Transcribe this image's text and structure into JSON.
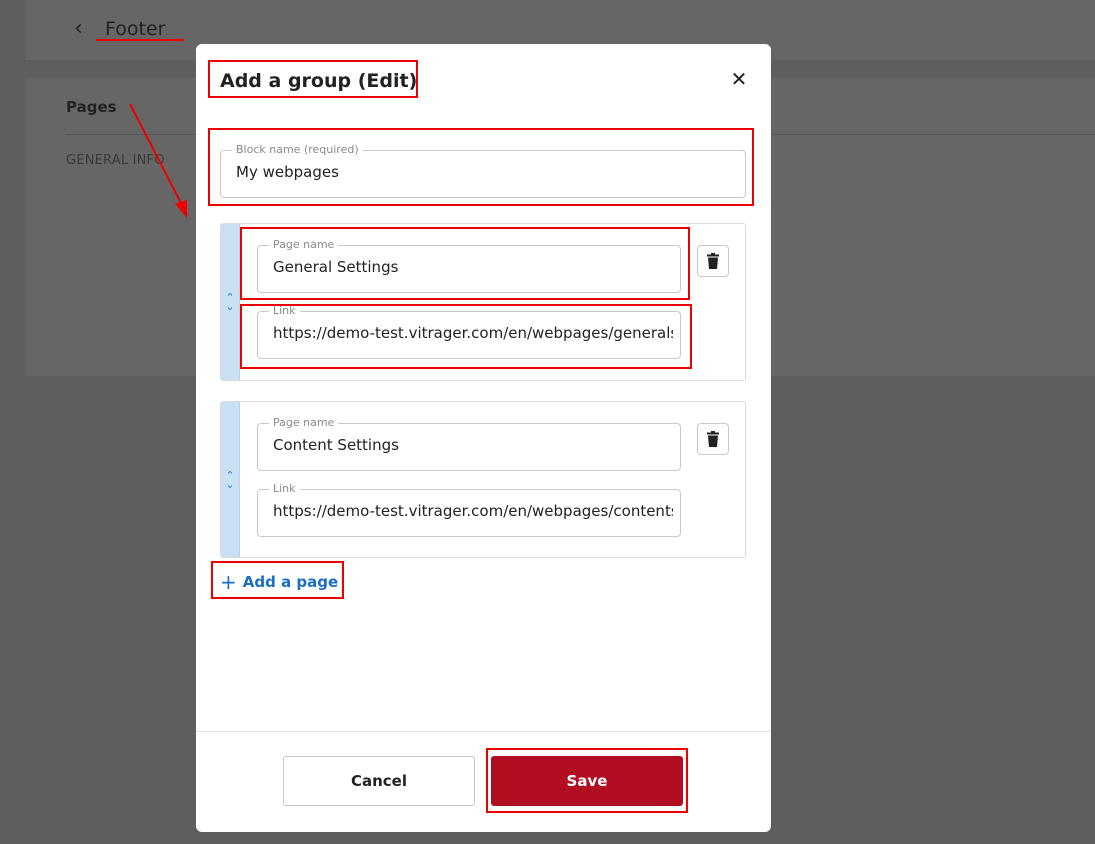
{
  "background": {
    "title": "Footer",
    "section_label": "Pages",
    "section_item": "GENERAL INFO",
    "back_icon": "chevron-left-icon"
  },
  "modal": {
    "title": "Add a group (Edit)",
    "close_icon": "close-icon",
    "block_name": {
      "label": "Block name (required)",
      "value": "My webpages"
    },
    "groups": [
      {
        "page_name_label": "Page name",
        "page_name_value": "General Settings",
        "link_label": "Link",
        "link_value": "https://demo-test.vitrager.com/en/webpages/generalsettings"
      },
      {
        "page_name_label": "Page name",
        "page_name_value": "Content Settings",
        "link_label": "Link",
        "link_value": "https://demo-test.vitrager.com/en/webpages/contentsettings"
      }
    ],
    "add_page_label": "Add a page",
    "cancel_label": "Cancel",
    "save_label": "Save"
  },
  "colors": {
    "accent_blue": "#1a6fc2",
    "save_red": "#b10e22",
    "annotation_red": "#e00000",
    "handle_blue": "#c9e0f3"
  }
}
